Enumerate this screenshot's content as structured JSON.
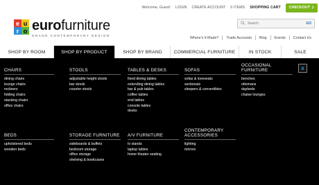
{
  "topbar": {
    "welcome": "Welcome, Guest!",
    "login": "LOGIN",
    "create_account": "CREATE ACCOUNT",
    "items": "0 ITEMS",
    "cart": "SHOPPING CART",
    "checkout": "CHECKOUT",
    "checkout_icon": "chevron-right-icon"
  },
  "brand": {
    "mark": [
      "e",
      "u",
      "r",
      "o"
    ],
    "word_bold": "euro",
    "word_light": "furniture",
    "tagline": "GRAND CONTEMPORARY DESIGN"
  },
  "search": {
    "placeholder": "Search",
    "button": "GO",
    "icon": "search-icon"
  },
  "header_links": [
    "Where's It Made?",
    "Trade Accounts",
    "Blog",
    "Events",
    "Contact Us"
  ],
  "nav": {
    "items": [
      {
        "label": "SHOP BY ROOM"
      },
      {
        "label": "SHOP BY PRODUCT"
      },
      {
        "label": "SHOP BY BRAND"
      },
      {
        "label": "COMMERCIAL FURNITURE"
      },
      {
        "label": "IN STOCK"
      },
      {
        "label": "SALE"
      }
    ],
    "active_index": 1
  },
  "menu": {
    "close_label": "x",
    "columns": [
      {
        "title": "CHAIRS",
        "links": [
          "dining chairs",
          "lounge chairs",
          "recliners",
          "folding chairs",
          "stacking chairs",
          "office chairs"
        ]
      },
      {
        "title": "STOOLS",
        "links": [
          "adjustable height stools",
          "bar stools",
          "counter stools"
        ]
      },
      {
        "title": "TABLES & DESKS",
        "links": [
          "fixed dining tables",
          "extending dining tables",
          "bar & pub tables",
          "coffee tables",
          "end tables",
          "console tables",
          "desks"
        ]
      },
      {
        "title": "SOFAS",
        "links": [
          "sofas & loveseats",
          "sectionals",
          "sleepers & convertibles"
        ]
      },
      {
        "title": "OCCASIONAL FURNITURE",
        "links": [
          "benches",
          "ottomans",
          "daybeds",
          "chaise lounges"
        ]
      },
      {
        "title": "BEDS",
        "links": [
          "upholstered beds",
          "wooden beds"
        ]
      },
      {
        "title": "STORAGE FURNITURE",
        "links": [
          "sideboards & buffets",
          "bedroom storage",
          "office storage",
          "shelving & bookcases"
        ]
      },
      {
        "title": "A/V FURNITURE",
        "links": [
          "tv stands",
          "laptop tables",
          "home theater seating"
        ]
      },
      {
        "title": "CONTEMPORARY ACCESSORIES",
        "links": [
          "lighting",
          "mirrors"
        ]
      }
    ]
  },
  "colors": {
    "checkout_bg": "#7ab51d",
    "menu_bg": "#000000",
    "close_x": "#2f9ce0"
  }
}
